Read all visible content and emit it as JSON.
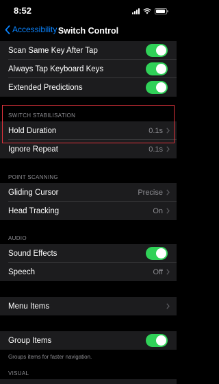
{
  "status": {
    "time": "8:52"
  },
  "nav": {
    "back_label": "Accessibility",
    "title": "Switch Control"
  },
  "top_group": {
    "items": [
      {
        "label": "Scan Same Key After Tap",
        "toggle_on": true
      },
      {
        "label": "Always Tap Keyboard Keys",
        "toggle_on": true
      },
      {
        "label": "Extended Predictions",
        "toggle_on": true
      }
    ]
  },
  "switch_stabilisation": {
    "header": "SWITCH STABILISATION",
    "items": [
      {
        "label": "Hold Duration",
        "value": "0.1s"
      },
      {
        "label": "Ignore Repeat",
        "value": "0.1s"
      }
    ]
  },
  "point_scanning": {
    "header": "POINT SCANNING",
    "items": [
      {
        "label": "Gliding Cursor",
        "value": "Precise"
      },
      {
        "label": "Head Tracking",
        "value": "On"
      }
    ]
  },
  "audio": {
    "header": "AUDIO",
    "items": [
      {
        "label": "Sound Effects",
        "toggle_on": true
      },
      {
        "label": "Speech",
        "value": "Off"
      }
    ]
  },
  "menu": {
    "label": "Menu Items"
  },
  "group_items": {
    "label": "Group Items",
    "toggle_on": true,
    "footer": "Groups items for faster navigation."
  },
  "visual": {
    "header": "VISUAL"
  },
  "colors": {
    "accent": "#0a84ff",
    "toggle": "#30d158",
    "highlight": "#e0333c"
  }
}
